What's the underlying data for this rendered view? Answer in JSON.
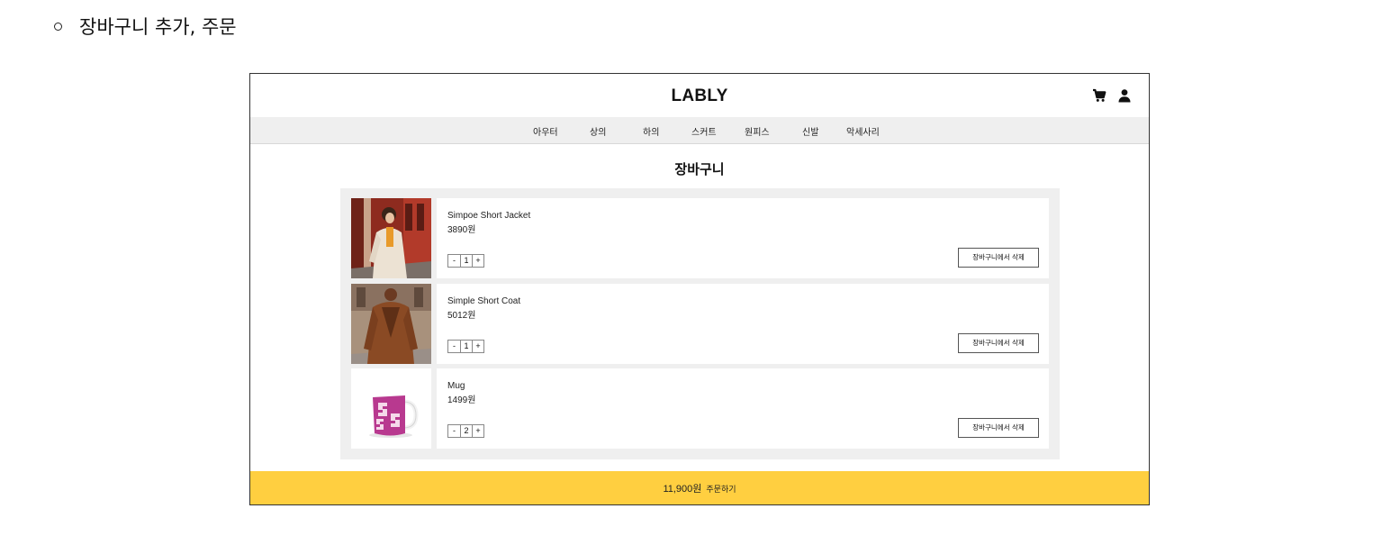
{
  "doc": {
    "heading": "장바구니 추가, 주문"
  },
  "header": {
    "logo": "LABLY",
    "icons": [
      "cart-icon",
      "user-icon"
    ]
  },
  "nav": {
    "items": [
      "아우터",
      "상의",
      "하의",
      "스커트",
      "원피스",
      "신발",
      "악세사리"
    ]
  },
  "cart": {
    "title": "장바구니",
    "items": [
      {
        "name": "Simpoe Short Jacket",
        "price": "3890원",
        "qty_minus": "-",
        "qty": "1",
        "qty_plus": "+",
        "delete_label": "장바구니에서 삭제"
      },
      {
        "name": "Simple Short Coat",
        "price": "5012원",
        "qty_minus": "-",
        "qty": "1",
        "qty_plus": "+",
        "delete_label": "장바구니에서 삭제"
      },
      {
        "name": "Mug",
        "price": "1499원",
        "qty_minus": "-",
        "qty": "2",
        "qty_plus": "+",
        "delete_label": "장바구니에서 삭제"
      }
    ]
  },
  "order": {
    "total": "11,900원",
    "label": "주문하기"
  },
  "colors": {
    "accent": "#ffcf40",
    "panel": "#efefef",
    "nav": "#efefef",
    "mug": "#b8398f"
  }
}
